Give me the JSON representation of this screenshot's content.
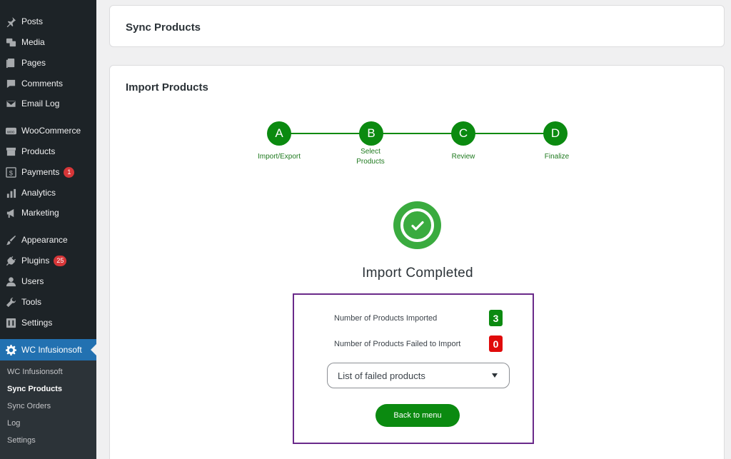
{
  "sidebar": {
    "items": [
      {
        "label": "Posts",
        "icon": "pushpin-icon"
      },
      {
        "label": "Media",
        "icon": "media-icon"
      },
      {
        "label": "Pages",
        "icon": "pages-icon"
      },
      {
        "label": "Comments",
        "icon": "comment-icon"
      },
      {
        "label": "Email Log",
        "icon": "email-icon"
      },
      {
        "label": "WooCommerce",
        "icon": "woo-icon"
      },
      {
        "label": "Products",
        "icon": "archive-icon"
      },
      {
        "label": "Payments",
        "icon": "dollar-icon",
        "badge": "1"
      },
      {
        "label": "Analytics",
        "icon": "chart-icon"
      },
      {
        "label": "Marketing",
        "icon": "megaphone-icon"
      },
      {
        "label": "Appearance",
        "icon": "brush-icon"
      },
      {
        "label": "Plugins",
        "icon": "plug-icon",
        "badge": "25"
      },
      {
        "label": "Users",
        "icon": "user-icon"
      },
      {
        "label": "Tools",
        "icon": "wrench-icon"
      },
      {
        "label": "Settings",
        "icon": "settings-icon"
      }
    ],
    "active": {
      "label": "WC Infusionsoft",
      "icon": "gear-icon"
    },
    "submenu": [
      "WC Infusionsoft",
      "Sync Products",
      "Sync Orders",
      "Log",
      "Settings"
    ],
    "badge_color": "#d63638",
    "active_color": "#2271b1"
  },
  "sync_card": {
    "title": "Sync Products"
  },
  "import_card": {
    "title": "Import Products",
    "steps": [
      {
        "letter": "A",
        "label": "Import/Export"
      },
      {
        "letter": "B",
        "label": "Select Products"
      },
      {
        "letter": "C",
        "label": "Review"
      },
      {
        "letter": "D",
        "label": "Finalize"
      }
    ],
    "status_title": "Import Completed",
    "imported_label": "Number of Products Imported",
    "imported_count": "3",
    "failed_label": "Number of Products Failed to Import",
    "failed_count": "0",
    "failed_select": "List of failed products",
    "back_button": "Back to menu",
    "accent_color": "#0b8a10",
    "error_color": "#e00b0b"
  }
}
